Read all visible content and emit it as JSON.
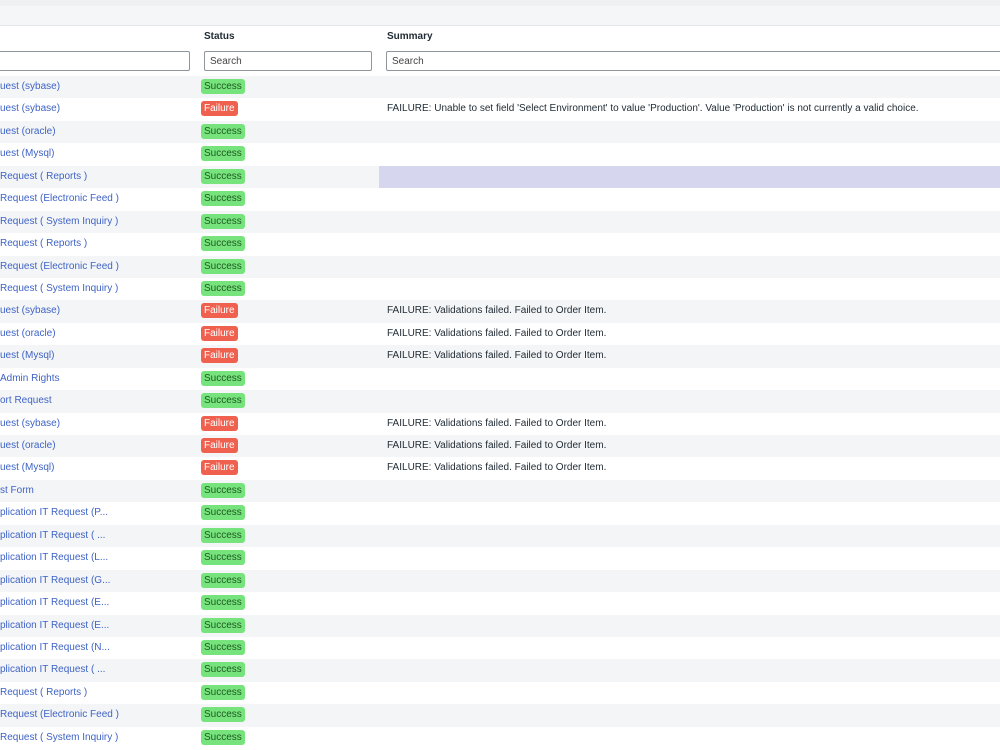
{
  "columns": {
    "status": "Status",
    "summary": "Summary"
  },
  "filters": {
    "name_placeholder": "",
    "status_placeholder": "Search",
    "summary_placeholder": "Search"
  },
  "colors": {
    "success": "#77e37d",
    "failure": "#f0604f",
    "link": "#3e63c6",
    "highlight": "#d6d7ef"
  },
  "rows": [
    {
      "name": "uest (sybase)",
      "status": "Success",
      "summary": ""
    },
    {
      "name": "uest (sybase)",
      "status": "Failure",
      "summary": "FAILURE: Unable to set field 'Select Environment' to value 'Production'. Value 'Production' is not currently a valid choice."
    },
    {
      "name": "uest (oracle)",
      "status": "Success",
      "summary": ""
    },
    {
      "name": "uest (Mysql)",
      "status": "Success",
      "summary": ""
    },
    {
      "name": "Request ( Reports )",
      "status": "Success",
      "summary": "",
      "highlight": true
    },
    {
      "name": "Request (Electronic Feed )",
      "status": "Success",
      "summary": ""
    },
    {
      "name": "Request ( System Inquiry )",
      "status": "Success",
      "summary": ""
    },
    {
      "name": "Request ( Reports )",
      "status": "Success",
      "summary": ""
    },
    {
      "name": "Request (Electronic Feed )",
      "status": "Success",
      "summary": ""
    },
    {
      "name": "Request ( System Inquiry )",
      "status": "Success",
      "summary": ""
    },
    {
      "name": "uest (sybase)",
      "status": "Failure",
      "summary": "FAILURE: Validations failed. Failed to Order Item."
    },
    {
      "name": "uest (oracle)",
      "status": "Failure",
      "summary": "FAILURE: Validations failed. Failed to Order Item."
    },
    {
      "name": "uest (Mysql)",
      "status": "Failure",
      "summary": "FAILURE: Validations failed. Failed to Order Item."
    },
    {
      "name": " Admin Rights",
      "status": "Success",
      "summary": ""
    },
    {
      "name": "ort Request",
      "status": "Success",
      "summary": ""
    },
    {
      "name": "uest (sybase)",
      "status": "Failure",
      "summary": "FAILURE: Validations failed. Failed to Order Item."
    },
    {
      "name": "uest (oracle)",
      "status": "Failure",
      "summary": "FAILURE: Validations failed. Failed to Order Item."
    },
    {
      "name": "uest (Mysql)",
      "status": "Failure",
      "summary": "FAILURE: Validations failed. Failed to Order Item."
    },
    {
      "name": "st Form",
      "status": "Success",
      "summary": ""
    },
    {
      "name": "plication IT Request (P...",
      "status": "Success",
      "summary": ""
    },
    {
      "name": "plication IT Request ( ...",
      "status": "Success",
      "summary": ""
    },
    {
      "name": "plication IT Request (L...",
      "status": "Success",
      "summary": ""
    },
    {
      "name": "plication IT Request (G...",
      "status": "Success",
      "summary": ""
    },
    {
      "name": "plication IT Request (E...",
      "status": "Success",
      "summary": ""
    },
    {
      "name": "plication IT Request (E...",
      "status": "Success",
      "summary": ""
    },
    {
      "name": "plication IT Request (N...",
      "status": "Success",
      "summary": ""
    },
    {
      "name": "plication IT Request ( ...",
      "status": "Success",
      "summary": ""
    },
    {
      "name": "Request ( Reports )",
      "status": "Success",
      "summary": ""
    },
    {
      "name": "Request (Electronic Feed )",
      "status": "Success",
      "summary": ""
    },
    {
      "name": "Request ( System Inquiry )",
      "status": "Success",
      "summary": ""
    }
  ]
}
